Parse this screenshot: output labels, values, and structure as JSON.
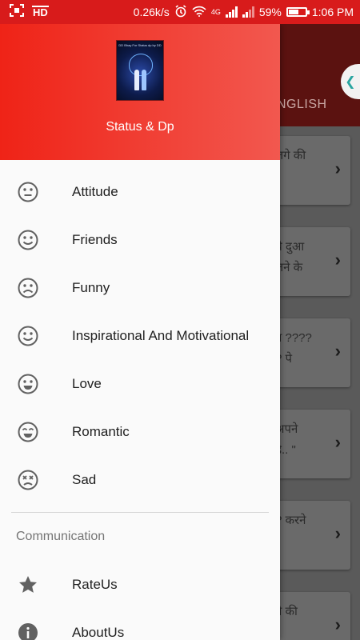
{
  "status_bar": {
    "speed": "0.26k/s",
    "network": "4G",
    "battery": "59%",
    "battery_fraction": 0.59,
    "time": "1:06 PM"
  },
  "background": {
    "tab_label": "NGLISH",
    "handle_icon": "chevron-left-icon",
    "cards": [
      {
        "text": "लगे की"
      },
      {
        "text": "ये दुआ\nलने के"
      },
      {
        "text": "न ????\n? पे"
      },
      {
        "text": "अपने\nहै.. \""
      },
      {
        "text": "? करने\n"
      },
      {
        "text": "ने की"
      }
    ]
  },
  "drawer": {
    "header_title": "Status & Dp",
    "logo_caption": "DD Bhay For Status dp by DD",
    "categories": [
      {
        "label": "Attitude",
        "icon": "neutral-face-icon"
      },
      {
        "label": "Friends",
        "icon": "smile-face-icon"
      },
      {
        "label": "Funny",
        "icon": "sad-face-icon"
      },
      {
        "label": "Inspirational And Motivational",
        "icon": "smile-face-icon"
      },
      {
        "label": "Love",
        "icon": "grin-face-icon"
      },
      {
        "label": "Romantic",
        "icon": "laugh-face-icon"
      },
      {
        "label": "Sad",
        "icon": "dizzy-face-icon"
      }
    ],
    "section_title": "Communication",
    "communication": [
      {
        "label": "RateUs",
        "icon": "star-icon"
      },
      {
        "label": "AboutUs",
        "icon": "info-icon"
      }
    ]
  }
}
